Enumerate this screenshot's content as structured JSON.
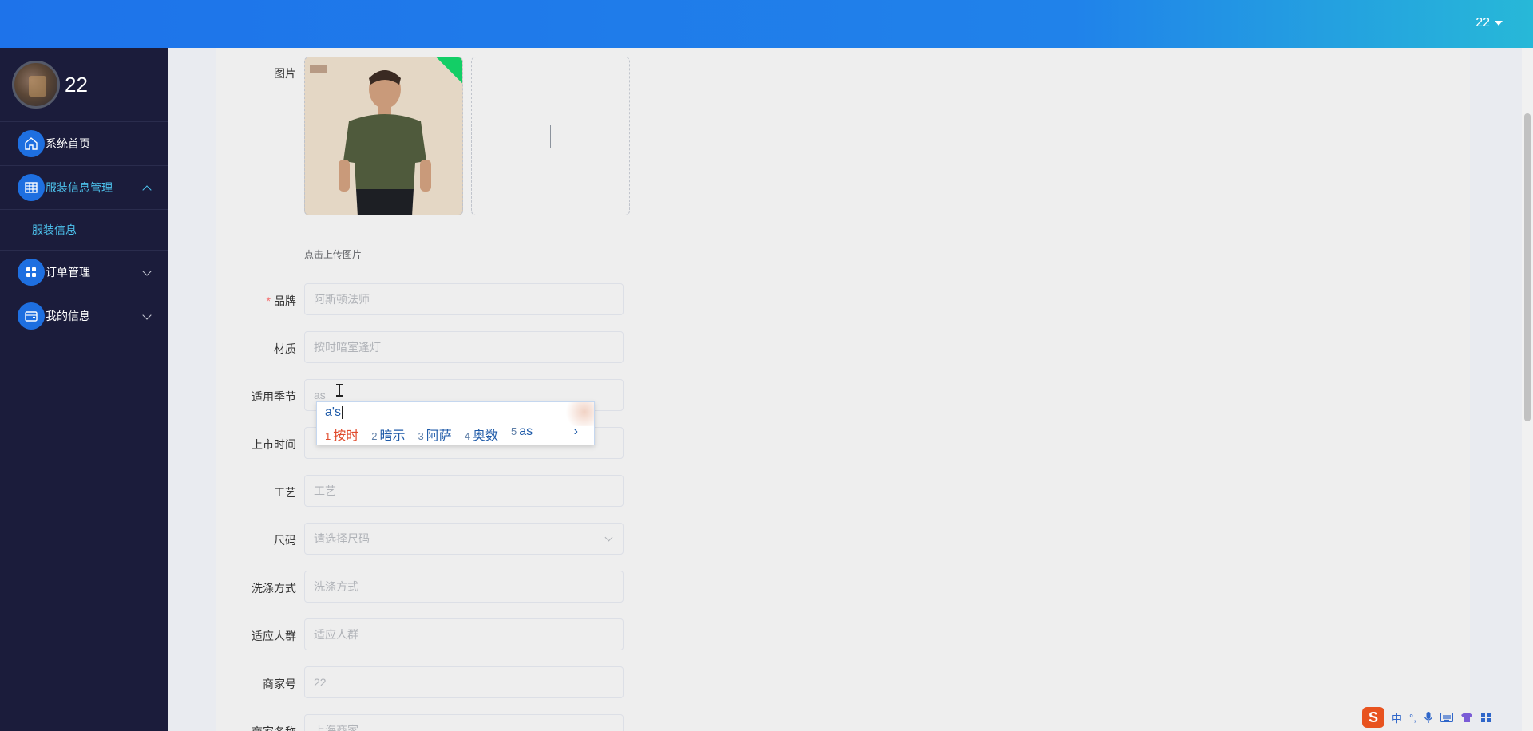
{
  "header": {
    "user": "22"
  },
  "sidebar": {
    "profile_name": "22",
    "items": [
      {
        "label": "系统首页",
        "icon": "home-icon"
      },
      {
        "label": "服装信息管理",
        "icon": "grid-table-icon"
      },
      {
        "label": "服装信息"
      },
      {
        "label": "订单管理",
        "icon": "apps-icon"
      },
      {
        "label": "我的信息",
        "icon": "wallet-icon"
      }
    ]
  },
  "form": {
    "image_label": "图片",
    "upload_tip": "点击上传图片",
    "brand_label": "品牌",
    "brand_value": "阿斯顿法师",
    "material_label": "材质",
    "material_value": "按时暗室逢灯",
    "season_label": "适用季节",
    "season_value": "as",
    "release_label": "上市时间",
    "craft_label": "工艺",
    "craft_placeholder": "工艺",
    "size_label": "尺码",
    "size_placeholder": "请选择尺码",
    "wash_label": "洗涤方式",
    "wash_placeholder": "洗涤方式",
    "crowd_label": "适应人群",
    "crowd_placeholder": "适应人群",
    "merchant_no_label": "商家号",
    "merchant_no_value": "22",
    "merchant_name_label": "商家名称",
    "merchant_name_value": "上海商家"
  },
  "ime": {
    "composition": "a's",
    "candidates": [
      {
        "num": "1",
        "text": "按时"
      },
      {
        "num": "2",
        "text": "暗示"
      },
      {
        "num": "3",
        "text": "阿萨"
      },
      {
        "num": "4",
        "text": "奥数"
      },
      {
        "num": "5",
        "text": "as"
      }
    ],
    "next": "›",
    "tray_mode": "中",
    "tray_punct": "°,"
  },
  "colors": {
    "topbar": "#1e73ea",
    "sidebar": "#1b1c3b",
    "active_menu": "#4dc3ee",
    "required": "#f56c6c",
    "upload_success": "#13ce66"
  }
}
